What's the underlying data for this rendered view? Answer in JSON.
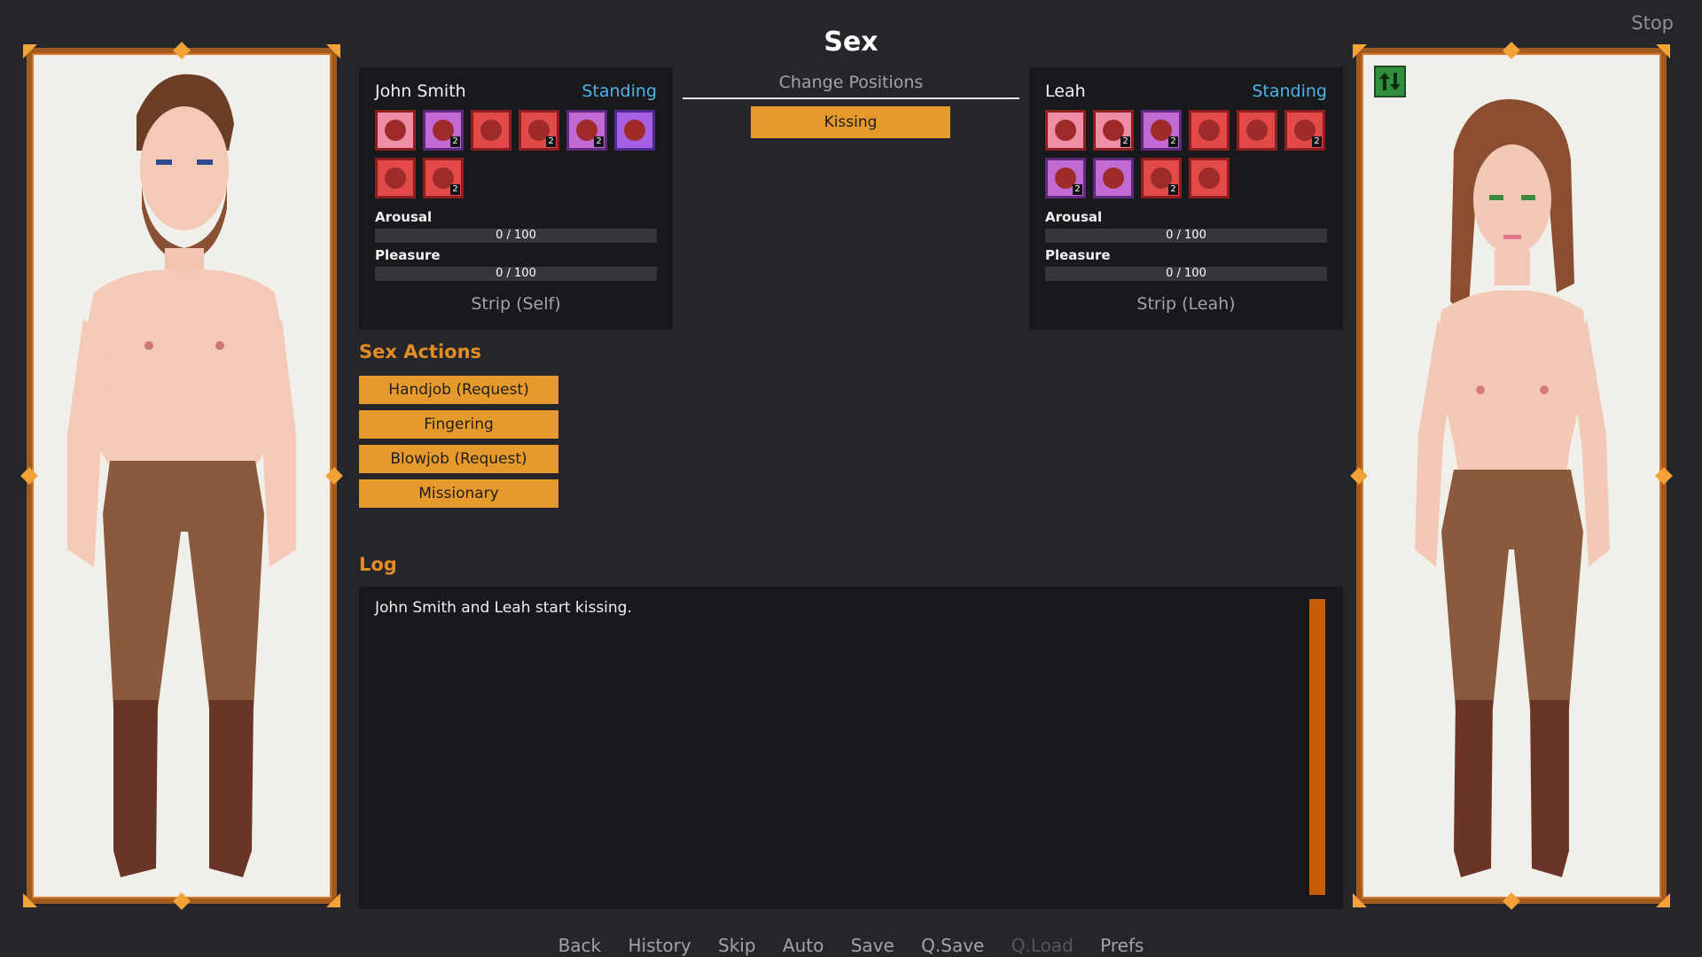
{
  "screen": {
    "title": "Sex",
    "stop_label": "Stop"
  },
  "left_character": {
    "name": "John Smith",
    "state": "Standing",
    "slots": [
      {
        "icon": "orifice-icon",
        "tone": "pink",
        "count": ""
      },
      {
        "icon": "breast-icon",
        "tone": "purple",
        "count": "2"
      },
      {
        "icon": "butt-icon",
        "tone": "red",
        "count": ""
      },
      {
        "icon": "foot-icon",
        "tone": "red",
        "count": "2"
      },
      {
        "icon": "hand-icon",
        "tone": "purple",
        "count": "2"
      },
      {
        "icon": "mouth-icon",
        "tone": "violet",
        "count": ""
      },
      {
        "icon": "penis-icon",
        "tone": "red",
        "count": ""
      },
      {
        "icon": "leg-icon",
        "tone": "red",
        "count": "2"
      }
    ],
    "arousal": {
      "label": "Arousal",
      "value": 0,
      "max": 100,
      "text": "0 / 100"
    },
    "pleasure": {
      "label": "Pleasure",
      "value": 0,
      "max": 100,
      "text": "0 / 100"
    },
    "strip_label": "Strip (Self)"
  },
  "right_character": {
    "name": "Leah",
    "state": "Standing",
    "slots": [
      {
        "icon": "orifice-icon",
        "tone": "pink",
        "count": ""
      },
      {
        "icon": "breast-icon",
        "tone": "pink",
        "count": "2"
      },
      {
        "icon": "breast-icon",
        "tone": "purple",
        "count": "2"
      },
      {
        "icon": "butt-icon",
        "tone": "red",
        "count": ""
      },
      {
        "icon": "vagina-icon",
        "tone": "red",
        "count": ""
      },
      {
        "icon": "foot-icon",
        "tone": "red",
        "count": "2"
      },
      {
        "icon": "hand-icon",
        "tone": "purple",
        "count": "2"
      },
      {
        "icon": "mouth-icon",
        "tone": "purple",
        "count": ""
      },
      {
        "icon": "leg-icon",
        "tone": "red",
        "count": "2"
      },
      {
        "icon": "groin-icon",
        "tone": "red",
        "count": ""
      }
    ],
    "arousal": {
      "label": "Arousal",
      "value": 0,
      "max": 100,
      "text": "0 / 100"
    },
    "pleasure": {
      "label": "Pleasure",
      "value": 0,
      "max": 100,
      "text": "0 / 100"
    },
    "strip_label": "Strip (Leah)"
  },
  "positions": {
    "change_label": "Change Positions",
    "current": "Kissing"
  },
  "actions": {
    "title": "Sex Actions",
    "items": [
      "Handjob (Request)",
      "Fingering",
      "Blowjob (Request)",
      "Missionary"
    ]
  },
  "log": {
    "title": "Log",
    "lines": [
      "John Smith and Leah start kissing."
    ]
  },
  "quick_menu": [
    {
      "label": "Back",
      "enabled": true
    },
    {
      "label": "History",
      "enabled": true
    },
    {
      "label": "Skip",
      "enabled": true
    },
    {
      "label": "Auto",
      "enabled": true
    },
    {
      "label": "Save",
      "enabled": true
    },
    {
      "label": "Q.Save",
      "enabled": true
    },
    {
      "label": "Q.Load",
      "enabled": false
    },
    {
      "label": "Prefs",
      "enabled": true
    }
  ],
  "colors": {
    "accent": "#e69a2b",
    "state": "#4fb3e8",
    "frame": "#a45a1f",
    "background": "#25262b"
  }
}
